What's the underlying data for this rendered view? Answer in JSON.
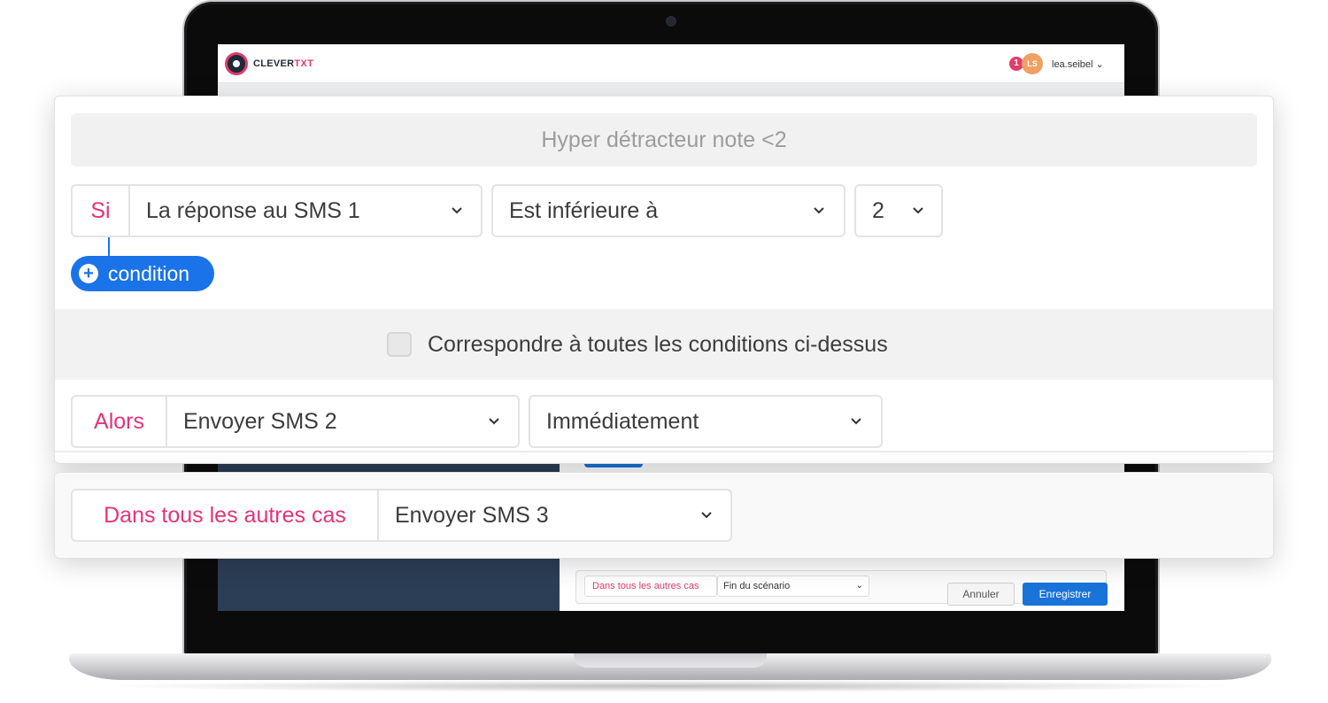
{
  "app": {
    "logo_text_main": "CLEVER",
    "logo_text_accent": "TXT",
    "notification_count": "1",
    "avatar_initials": "LS",
    "username": "lea.seibel ⌄"
  },
  "background_screen": {
    "else_label": "Dans tous les autres cas",
    "else_action": "Fin du scénario",
    "cancel_label": "Annuler",
    "save_label": "Enregistrer"
  },
  "rule": {
    "name": "Hyper détracteur note <2",
    "condition": {
      "if_label": "Si",
      "field": "La réponse au SMS 1",
      "operator": "Est inférieure à",
      "value": "2"
    },
    "add_condition_label": "condition",
    "match_all_label": "Correspondre à toutes les conditions ci-dessus",
    "match_all_checked": false,
    "then": {
      "then_label": "Alors",
      "action": "Envoyer SMS 2",
      "timing": "Immédiatement"
    }
  },
  "else_card": {
    "else_label": "Dans tous les autres cas",
    "action": "Envoyer SMS 3"
  },
  "colors": {
    "accent_pink": "#e5337a",
    "primary_blue": "#1a73e8"
  }
}
